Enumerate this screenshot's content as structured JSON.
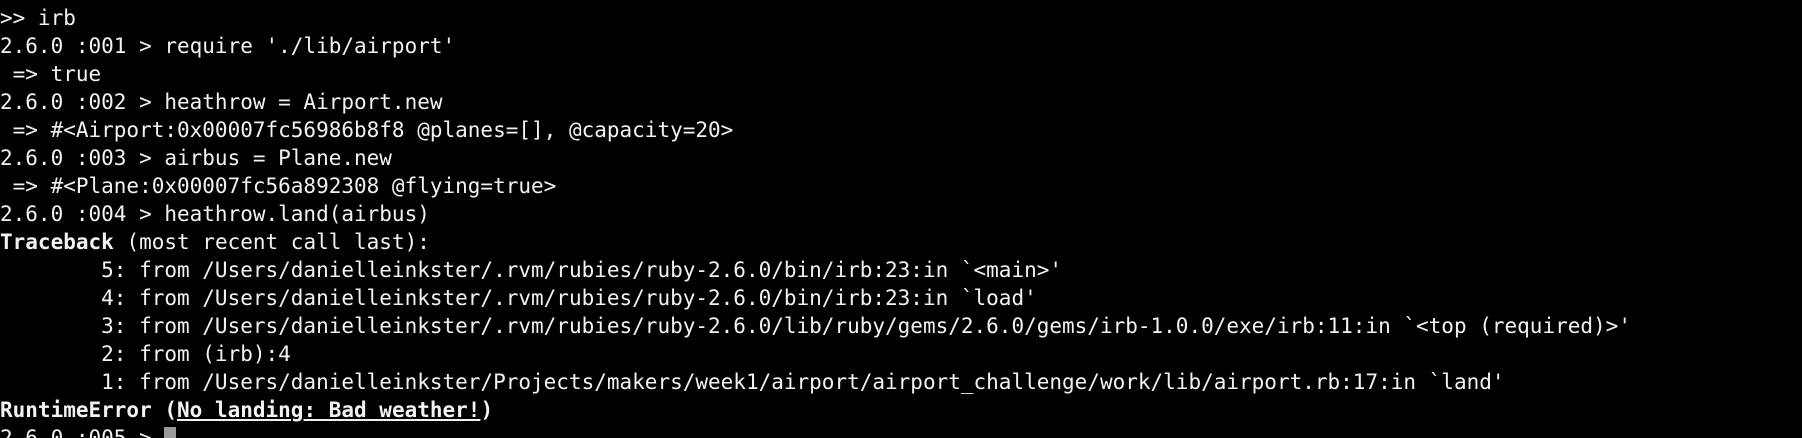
{
  "terminal": {
    "cmd_irb": ">> irb",
    "line1": "2.6.0 :001 > require './lib/airport'",
    "line2": " => true",
    "line3": "2.6.0 :002 > heathrow = Airport.new",
    "line4": " => #<Airport:0x00007fc56986b8f8 @planes=[], @capacity=20>",
    "line5": "2.6.0 :003 > airbus = Plane.new",
    "line6": " => #<Plane:0x00007fc56a892308 @flying=true>",
    "line7": "2.6.0 :004 > heathrow.land(airbus)",
    "traceback_label": "Traceback",
    "traceback_rest": " (most recent call last):",
    "trace5": "        5: from /Users/danielleinkster/.rvm/rubies/ruby-2.6.0/bin/irb:23:in `<main>'",
    "trace4": "        4: from /Users/danielleinkster/.rvm/rubies/ruby-2.6.0/bin/irb:23:in `load'",
    "trace3": "        3: from /Users/danielleinkster/.rvm/rubies/ruby-2.6.0/lib/ruby/gems/2.6.0/gems/irb-1.0.0/exe/irb:11:in `<top (required)>'",
    "trace2": "        2: from (irb):4",
    "trace1": "        1: from /Users/danielleinkster/Projects/makers/week1/airport/airport_challenge/work/lib/airport.rb:17:in `land'",
    "error_class": "RuntimeError (",
    "error_message": "No landing: Bad weather!",
    "error_close": ")",
    "prompt": "2.6.0 :005 > "
  },
  "colors": {
    "background": "#000000",
    "foreground": "#f2f2f2",
    "cursor": "#9a9a9a"
  }
}
